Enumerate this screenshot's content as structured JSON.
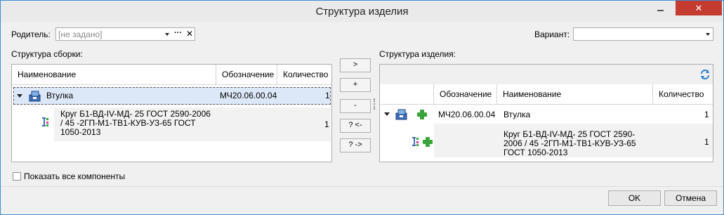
{
  "window": {
    "title": "Структура изделия",
    "close_glyph": "✕"
  },
  "parent": {
    "label": "Родитель:",
    "placeholder": "[не задано]",
    "more_label": "···",
    "clear_label": "✕"
  },
  "variant": {
    "label": "Вариант:",
    "value": ""
  },
  "assembly": {
    "title": "Структура сборки:",
    "columns": [
      "Наименование",
      "Обозначение",
      "Количество"
    ],
    "rows": [
      {
        "name": "Втулка",
        "designation": "МЧ20.06.00.04",
        "qty": "1"
      },
      {
        "name": "Круг Б1-ВД-IV-МД- 25 ГОСТ 2590-2006 / 45 -2ГП-М1-ТВ1-КУВ-УЗ-65 ГОСТ 1050-2013",
        "designation": "",
        "qty": "1"
      }
    ]
  },
  "middle_buttons": [
    ">",
    "+",
    "-",
    "? <-",
    "? ->"
  ],
  "product": {
    "title": "Структура изделия:",
    "columns": [
      "",
      "Обозначение",
      "Наименование",
      "Количество"
    ],
    "rows": [
      {
        "designation": "МЧ20.06.00.04",
        "name": "Втулка",
        "qty": "1"
      },
      {
        "designation": "",
        "name": "Круг Б1-ВД-IV-МД- 25 ГОСТ 2590-2006 / 45 -2ГП-М1-ТВ1-КУВ-УЗ-65 ГОСТ 1050-2013",
        "qty": "1"
      }
    ]
  },
  "show_all": {
    "label": "Показать все компоненты",
    "checked": false
  },
  "buttons": {
    "ok": "OK",
    "cancel": "Отмена"
  }
}
